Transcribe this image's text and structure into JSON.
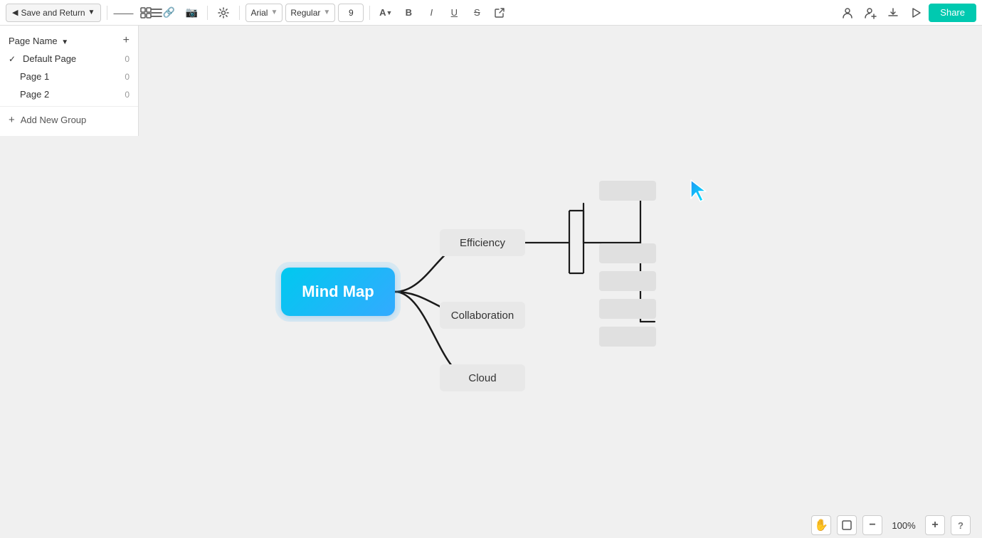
{
  "toolbar": {
    "save_return": "Save and Return",
    "share": "Share",
    "font_family": "Arial",
    "font_style": "Regular",
    "font_size": "9",
    "bold": "B",
    "italic": "I",
    "underline": "U",
    "strikethrough": "S"
  },
  "panel": {
    "header": "Page Name",
    "items": [
      {
        "label": "Default Page",
        "count": "0",
        "active": true
      },
      {
        "label": "Page 1",
        "count": "0",
        "active": false
      },
      {
        "label": "Page 2",
        "count": "0",
        "active": false
      }
    ],
    "add_group": "Add New Group"
  },
  "mindmap": {
    "center": "Mind Map",
    "branches": [
      "Efficiency",
      "Collaboration",
      "Cloud"
    ]
  },
  "bottombar": {
    "zoom": "100%"
  }
}
